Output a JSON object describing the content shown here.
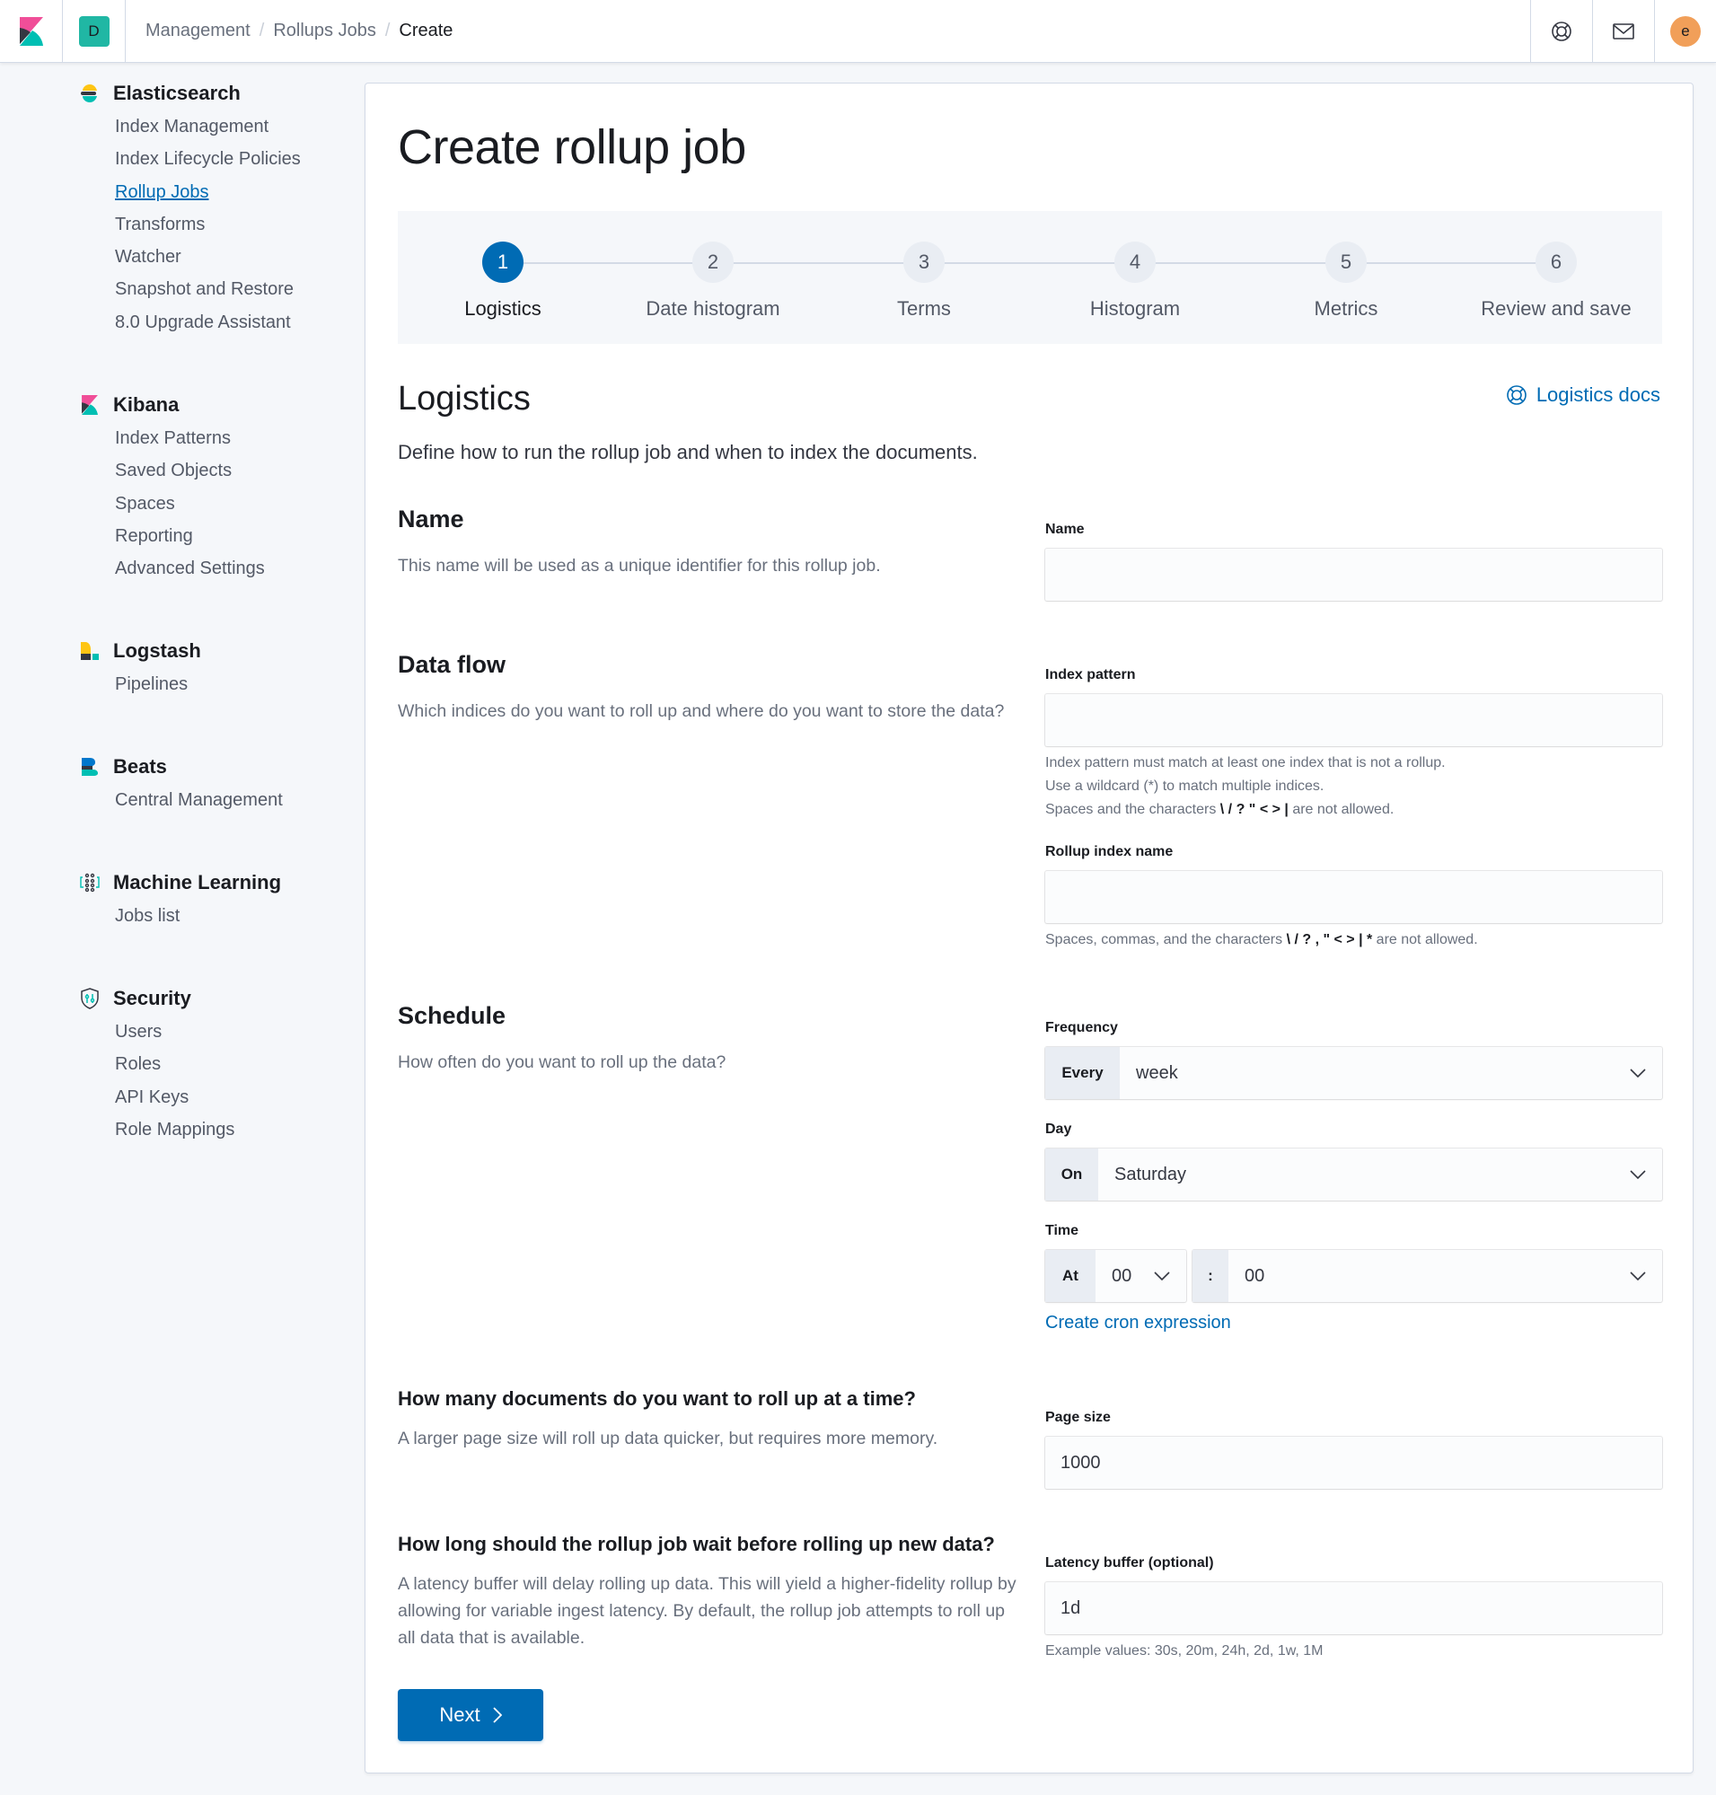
{
  "header": {
    "space_initial": "D",
    "breadcrumbs": [
      "Management",
      "Rollups Jobs",
      "Create"
    ],
    "avatar_initial": "e",
    "icons": {
      "help": "help-lifebuoy-icon",
      "news": "newsfeed-mail-icon"
    }
  },
  "sidebar": {
    "groups": [
      {
        "title": "Elasticsearch",
        "icon": "elasticsearch-logo-icon",
        "items": [
          "Index Management",
          "Index Lifecycle Policies",
          "Rollup Jobs",
          "Transforms",
          "Watcher",
          "Snapshot and Restore",
          "8.0 Upgrade Assistant"
        ],
        "active_item": "Rollup Jobs"
      },
      {
        "title": "Kibana",
        "icon": "kibana-logo-icon",
        "items": [
          "Index Patterns",
          "Saved Objects",
          "Spaces",
          "Reporting",
          "Advanced Settings"
        ]
      },
      {
        "title": "Logstash",
        "icon": "logstash-logo-icon",
        "items": [
          "Pipelines"
        ]
      },
      {
        "title": "Beats",
        "icon": "beats-logo-icon",
        "items": [
          "Central Management"
        ]
      },
      {
        "title": "Machine Learning",
        "icon": "machine-learning-icon",
        "items": [
          "Jobs list"
        ]
      },
      {
        "title": "Security",
        "icon": "security-shield-icon",
        "items": [
          "Users",
          "Roles",
          "API Keys",
          "Role Mappings"
        ]
      }
    ]
  },
  "page": {
    "title": "Create rollup job",
    "steps": [
      {
        "number": "1",
        "label": "Logistics",
        "active": true
      },
      {
        "number": "2",
        "label": "Date histogram",
        "active": false
      },
      {
        "number": "3",
        "label": "Terms",
        "active": false
      },
      {
        "number": "4",
        "label": "Histogram",
        "active": false
      },
      {
        "number": "5",
        "label": "Metrics",
        "active": false
      },
      {
        "number": "6",
        "label": "Review and save",
        "active": false
      }
    ],
    "section_title": "Logistics",
    "docs_link": "Logistics docs",
    "section_description": "Define how to run the rollup job and when to index the documents."
  },
  "form": {
    "name": {
      "title": "Name",
      "description": "This name will be used as a unique identifier for this rollup job.",
      "label": "Name",
      "value": ""
    },
    "data_flow": {
      "title": "Data flow",
      "description": "Which indices do you want to roll up and where do you want to store the data?",
      "index_pattern_label": "Index pattern",
      "index_pattern_value": "",
      "index_pattern_help": [
        "Index pattern must match at least one index that is not a rollup.",
        "Use a wildcard (*) to match multiple indices."
      ],
      "index_pattern_help_chars_prefix": "Spaces and the characters ",
      "index_pattern_help_chars": "\\ / ? \" < > |",
      "index_pattern_help_chars_suffix": " are not allowed.",
      "rollup_index_label": "Rollup index name",
      "rollup_index_value": "",
      "rollup_index_help_prefix": "Spaces, commas, and the characters ",
      "rollup_index_help_chars": "\\ / ? , \" < > | *",
      "rollup_index_help_suffix": " are not allowed."
    },
    "schedule": {
      "title": "Schedule",
      "description": "How often do you want to roll up the data?",
      "frequency_label": "Frequency",
      "frequency_prepend": "Every",
      "frequency_value": "week",
      "day_label": "Day",
      "day_prepend": "On",
      "day_value": "Saturday",
      "time_label": "Time",
      "time_prepend": "At",
      "hour_value": "00",
      "minute_prepend": ":",
      "minute_value": "00",
      "cron_link": "Create cron expression"
    },
    "page_size": {
      "title": "How many documents do you want to roll up at a time?",
      "description": "A larger page size will roll up data quicker, but requires more memory.",
      "label": "Page size",
      "value": "1000"
    },
    "latency": {
      "title": "How long should the rollup job wait before rolling up new data?",
      "description": "A latency buffer will delay rolling up data. This will yield a higher-fidelity rollup by allowing for variable ingest latency. By default, the rollup job attempts to roll up all data that is available.",
      "label": "Latency buffer (optional)",
      "value": "1d",
      "help": "Example values: 30s, 20m, 24h, 2d, 1w, 1M"
    }
  },
  "actions": {
    "next_label": "Next"
  },
  "colors": {
    "primary": "#006bb4",
    "space": "#20b7a4",
    "avatar": "#f19f59"
  }
}
